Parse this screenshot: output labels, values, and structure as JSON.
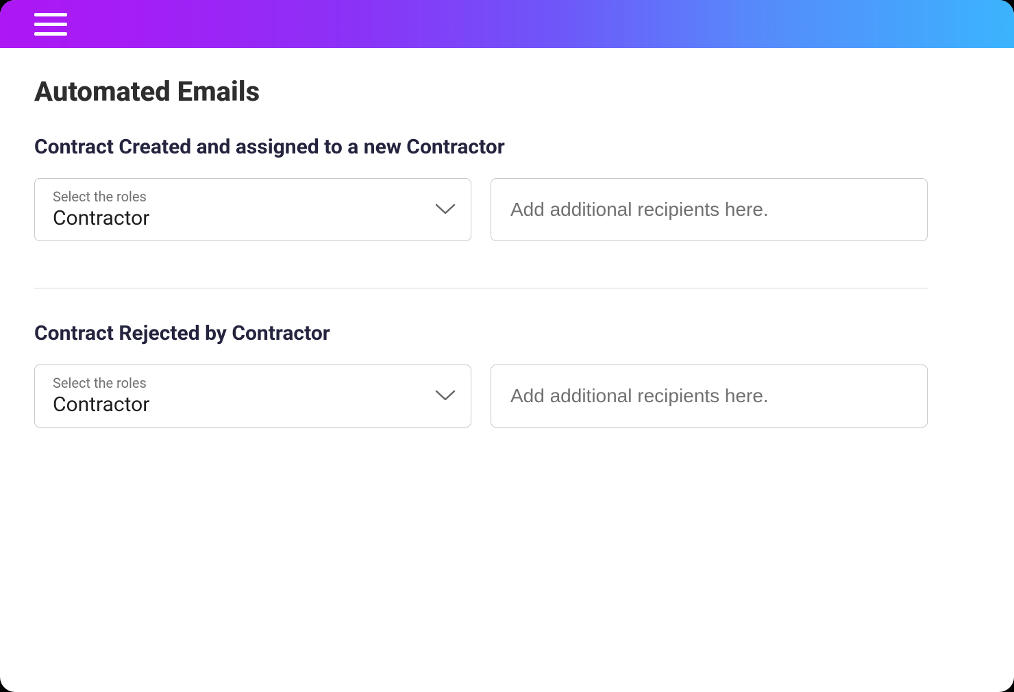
{
  "page": {
    "title": "Automated Emails"
  },
  "sections": [
    {
      "heading": "Contract Created and assigned to a new Contractor",
      "roles_label": "Select the roles",
      "roles_value": "Contractor",
      "recipients_placeholder": "Add additional recipients here.",
      "recipients_value": ""
    },
    {
      "heading": "Contract Rejected by Contractor",
      "roles_label": "Select the roles",
      "roles_value": "Contractor",
      "recipients_placeholder": "Add additional recipients here.",
      "recipients_value": ""
    }
  ],
  "colors": {
    "gradient_start": "#ad17f4",
    "gradient_end": "#3bb4fd",
    "heading_dark_blue": "#24243f",
    "title_gray": "#2e2e2e",
    "border_gray": "#c8c8c8",
    "muted_text": "#707070"
  },
  "icons": {
    "hamburger": "hamburger-menu",
    "chevron_down": "chevron-down"
  }
}
